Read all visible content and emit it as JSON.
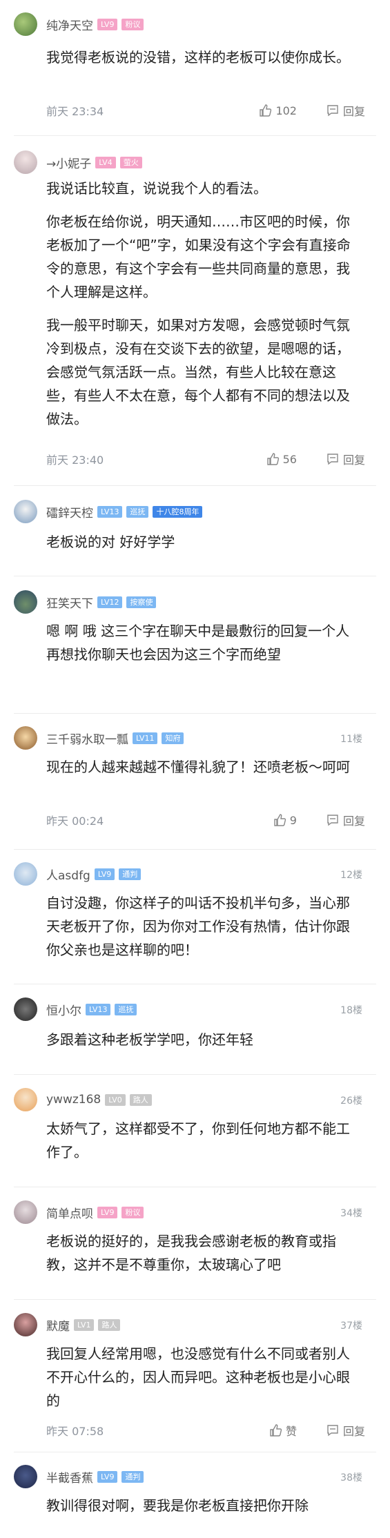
{
  "colors": {
    "pink": "#f5a3c7",
    "blue": "#7cb7f3",
    "gray": "#c8c8c8",
    "text": "#222222",
    "muted": "#8f959e",
    "darkblue": "#3f86e8"
  },
  "comments": [
    {
      "user": "纯净天空",
      "badges": [
        "LV9",
        "粉议"
      ],
      "badge_color": "#f5a3c7",
      "paras": [
        "我觉得老板说的没错，这样的老板可以使你成长。"
      ],
      "time": "前天 23:34",
      "likes": "102",
      "reply": "回复",
      "floor": ""
    },
    {
      "user": "→小妮子",
      "badges": [
        "LV4",
        "萤火"
      ],
      "badge_color": "#f5a3c7",
      "paras": [
        "我说话比较直，说说我个人的看法。",
        "你老板在给你说，明天通知……市区吧的时候，你老板加了一个“吧”字，如果没有这个字会有直接命令的意思，有这个字会有一些共同商量的意思，我个人理解是这样。",
        "我一般平时聊天，如果对方发嗯，会感觉顿时气氛冷到极点，没有在交谈下去的欲望，是嗯嗯的话，会感觉气氛活跃一点。当然，有些人比较在意这些，有些人不太在意，每个人都有不同的想法以及做法。"
      ],
      "time": "前天 23:40",
      "likes": "56",
      "reply": "回复",
      "floor": ""
    },
    {
      "user": "礌鋅天椌",
      "badges": [
        "LV13",
        "巡抚",
        "十八腔8周年"
      ],
      "badge_color": "#7cb7f3",
      "paras": [
        "老板说的对 好好学学"
      ],
      "time": "",
      "likes": "",
      "reply": "",
      "floor": ""
    },
    {
      "user": "狂笑天下",
      "badges": [
        "LV12",
        "按察使"
      ],
      "badge_color": "#7cb7f3",
      "paras": [
        "嗯 啊 哦 这三个字在聊天中是最敷衍的回复一个人再想找你聊天也会因为这三个字而绝望"
      ],
      "time": "",
      "likes": "",
      "reply": "",
      "floor": ""
    },
    {
      "user": "三千弱水取一瓢",
      "badges": [
        "LV11",
        "知府"
      ],
      "badge_color": "#7cb7f3",
      "paras": [
        "现在的人越来越越不懂得礼貌了！还喷老板～呵呵"
      ],
      "time": "昨天 00:24",
      "likes": "9",
      "reply": "回复",
      "floor": "11楼"
    },
    {
      "user": "人asdfg",
      "badges": [
        "LV9",
        "通判"
      ],
      "badge_color": "#7cb7f3",
      "paras": [
        "自讨没趣，你这样子的叫话不投机半句多，当心那天老板开了你，因为你对工作没有热情，估计你跟你父亲也是这样聊的吧！"
      ],
      "time": "",
      "likes": "",
      "reply": "",
      "floor": "12楼"
    },
    {
      "user": "恒小尔",
      "badges": [
        "LV13",
        "巡抚"
      ],
      "badge_color": "#7cb7f3",
      "paras": [
        "多跟着这种老板学学吧，你还年轻"
      ],
      "time": "",
      "likes": "",
      "reply": "",
      "floor": "18楼"
    },
    {
      "user": "ywwz168",
      "badges": [
        "LV0",
        "路人"
      ],
      "badge_color": "#c8c8c8",
      "paras": [
        "太娇气了，这样都受不了，你到任何地方都不能工作了。"
      ],
      "time": "",
      "likes": "",
      "reply": "",
      "floor": "26楼"
    },
    {
      "user": "简单点呗",
      "badges": [
        "LV9",
        "粉议"
      ],
      "badge_color": "#f5a3c7",
      "paras": [
        "老板说的挺好的，是我我会感谢老板的教育或指教，这并不是不尊重你，太玻璃心了吧"
      ],
      "time": "",
      "likes": "",
      "reply": "",
      "floor": "34楼"
    },
    {
      "user": "默魔",
      "badges": [
        "LV1",
        "路人"
      ],
      "badge_color": "#c8c8c8",
      "paras": [
        "我回复人经常用嗯，也没感觉有什么不同或者别人不开心什么的，因人而异吧。这种老板也是小心眼的"
      ],
      "time": "昨天 07:58",
      "likes": "赞",
      "reply": "回复",
      "floor": "37楼"
    },
    {
      "user": "半截香蕉",
      "badges": [
        "LV9",
        "通判"
      ],
      "badge_color": "#7cb7f3",
      "paras": [
        "教训得很对啊，要我是你老板直接把你开除"
      ],
      "time": "",
      "likes": "",
      "reply": "",
      "floor": "38楼"
    }
  ]
}
